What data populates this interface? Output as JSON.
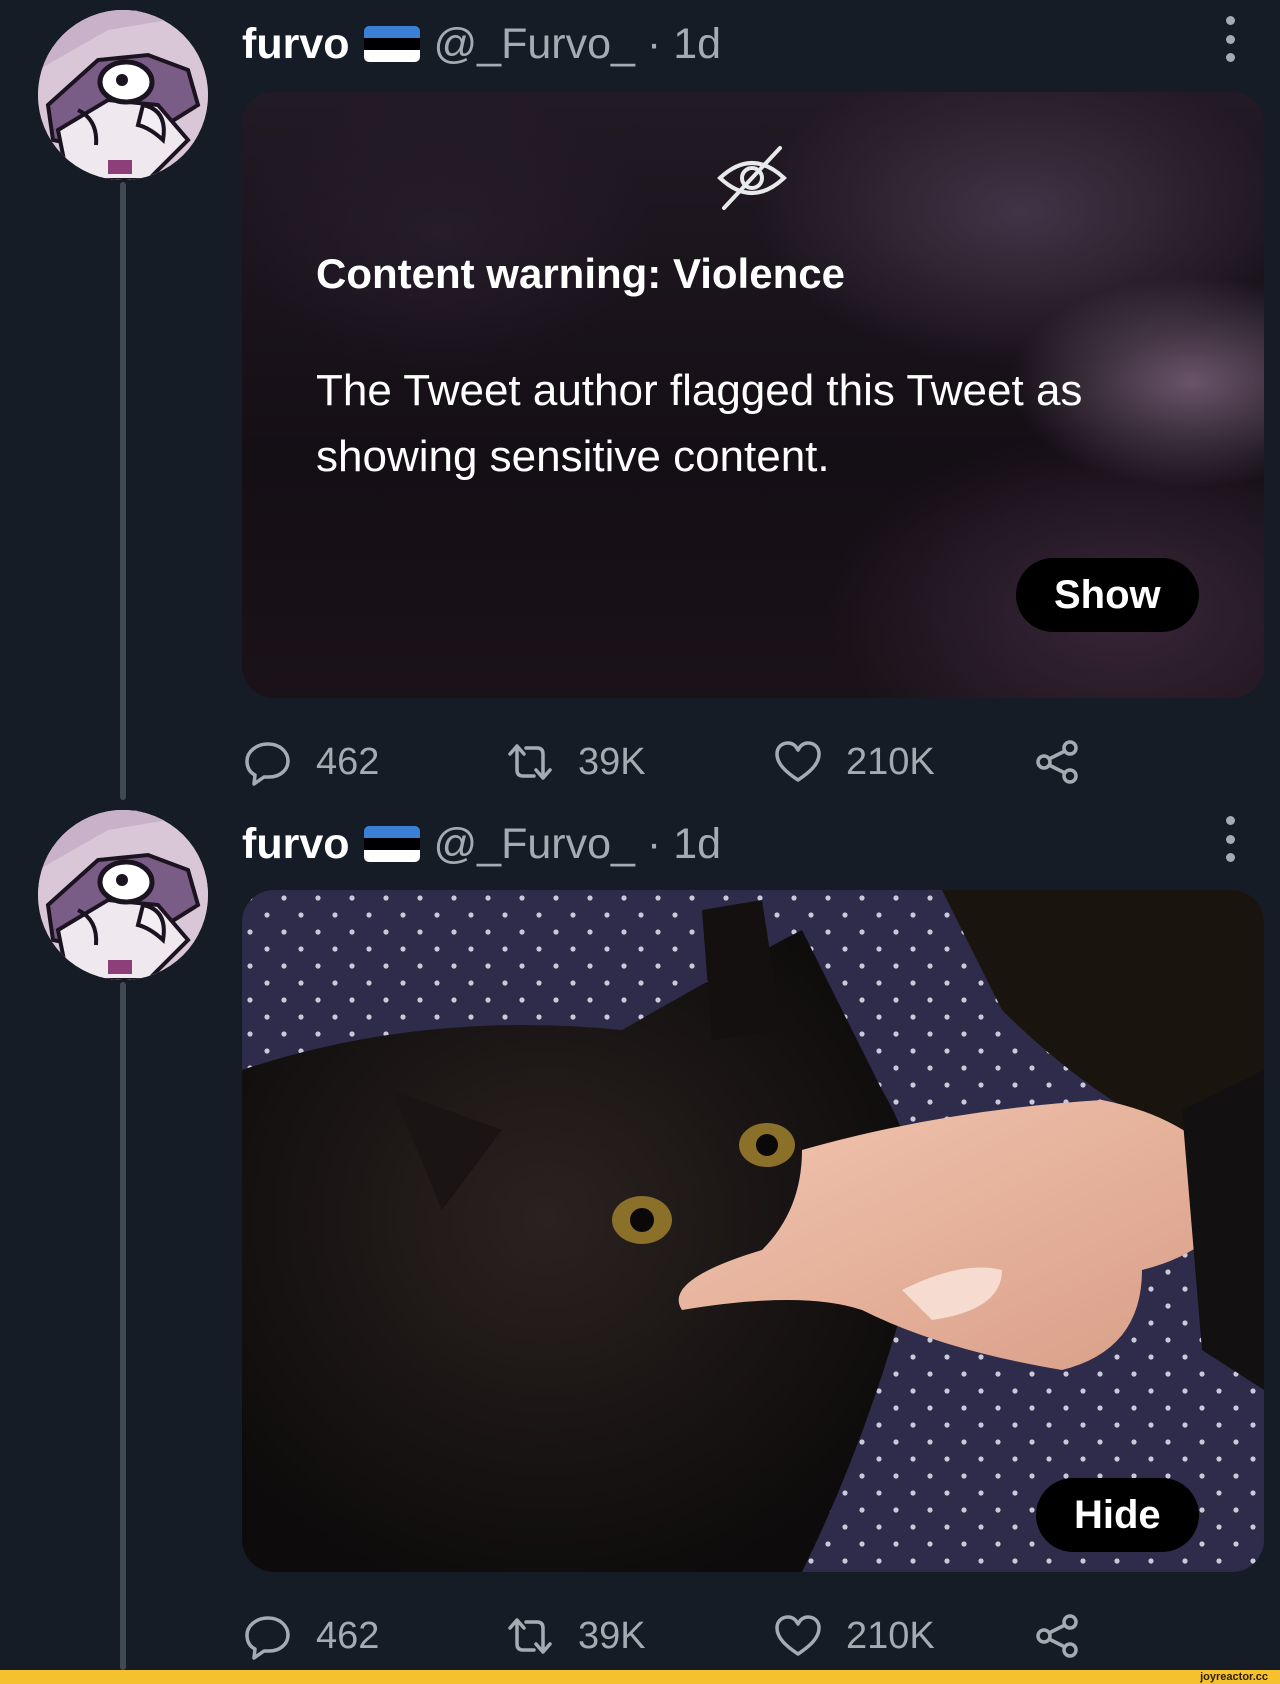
{
  "colors": {
    "background": "#151c26",
    "thread_line": "#3f4a55",
    "muted_text": "#a3abb3",
    "flag_blue": "#3b7fd6",
    "flag_black": "#000000",
    "flag_white": "#ffffff",
    "footer_bar": "#f6c12e"
  },
  "tweets": [
    {
      "author": {
        "name": "furvo",
        "handle": "@_Furvo_",
        "separator": "·",
        "time": "1d",
        "flag_icon": "estonia-flag-icon"
      },
      "media": {
        "kind": "sensitive-warning",
        "icon": "eye-off-icon",
        "warning_title": "Content warning: Violence",
        "warning_text": "The Tweet author flagged this Tweet as showing sensitive content.",
        "button_label": "Show"
      },
      "actions": {
        "replies": "462",
        "retweets": "39K",
        "likes": "210K"
      }
    },
    {
      "author": {
        "name": "furvo",
        "handle": "@_Furvo_",
        "separator": "·",
        "time": "1d",
        "flag_icon": "estonia-flag-icon"
      },
      "media": {
        "kind": "photo",
        "description_icon": "black-cat-biting-finger-photo",
        "button_label": "Hide"
      },
      "actions": {
        "replies": "462",
        "retweets": "39K",
        "likes": "210K"
      }
    }
  ],
  "footer": {
    "site": "joyreactor.cc"
  }
}
